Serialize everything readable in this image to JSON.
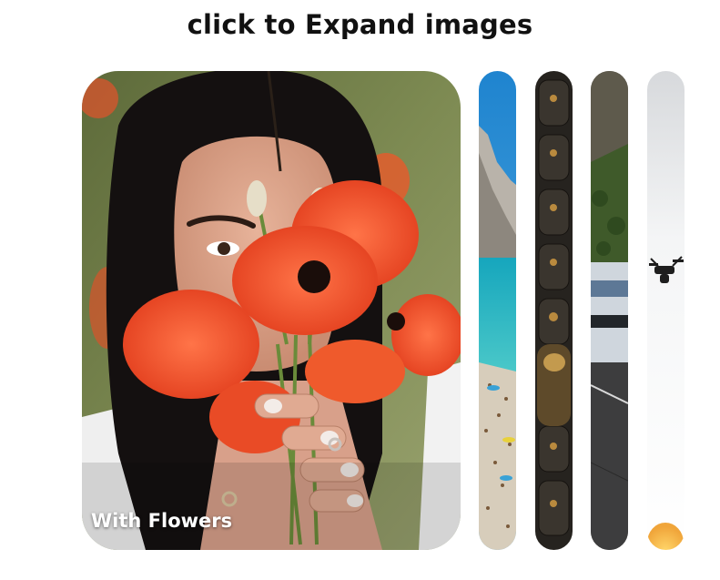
{
  "page": {
    "title": "click to Expand images"
  },
  "panels": [
    {
      "caption": "With Flowers",
      "active": true,
      "subject": "woman holding red poppy bouquet"
    },
    {
      "caption": "",
      "active": false,
      "subject": "beach cliff with turquoise sea"
    },
    {
      "caption": "",
      "active": false,
      "subject": "dark stone carved relief with lamps"
    },
    {
      "caption": "",
      "active": false,
      "subject": "white sports car on road"
    },
    {
      "caption": "",
      "active": false,
      "subject": "drone on white background"
    }
  ],
  "colors": {
    "title": "#111111",
    "caption": "#ffffff",
    "poppy": "#f0502a",
    "sea": "#19b2c4",
    "sky": "#2f8fd0"
  }
}
